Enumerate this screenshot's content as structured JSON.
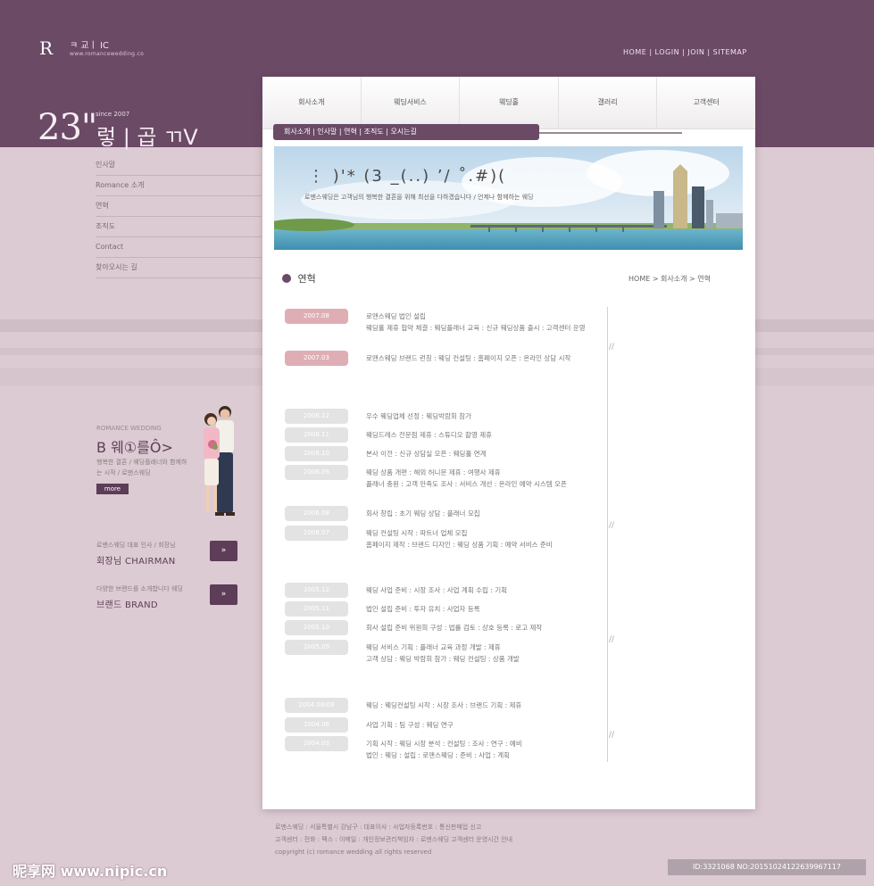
{
  "header": {
    "logo_letter": "R",
    "logo_name": "ㅋ 교ㅣ IC",
    "logo_sub": "www.romancewedding.co",
    "top_links": "HOME | LOGIN | JOIN | SITEMAP",
    "hero_number": "23\"",
    "hero_small": "since 2007",
    "hero_title": "렇 | 곱 ㄲV"
  },
  "left_nav": {
    "items": [
      "인사말",
      "Romance 소개",
      "연혁",
      "조직도",
      "Contact",
      "찾아오시는 길"
    ]
  },
  "promo": {
    "kicker": "ROMANCE WEDDING",
    "title": "B 웨①를Ô>",
    "desc": "행복한 결혼 / 웨딩플래너와 함께하는 시작 / 로맨스웨딩",
    "badge": "more"
  },
  "side_blocks": [
    {
      "desc": "로맨스웨딩 대표 인사 / 회장님",
      "name": "회장님 CHAIRMAN",
      "arrow": "»"
    },
    {
      "desc": "다양한 브랜드를 소개합니다 웨딩",
      "name": "브랜드 BRAND",
      "arrow": "»"
    }
  ],
  "tabs": [
    "회사소개",
    "웨딩서비스",
    "웨딩홀",
    "갤러리",
    "고객센터"
  ],
  "subnav": "회사소개 | 인사말 | 연혁 | 조직도 | 오시는길",
  "banner": {
    "title": "⋮ )'*   (3    _(..)   ’/   ˚.#)(",
    "sub": "로맨스웨딩은 고객님의 행복한 결혼을 위해 최선을 다하겠습니다 / 언제나 함께하는 웨딩"
  },
  "section": {
    "title": "연혁",
    "breadcrumb": "HOME > 회사소개 > 연혁"
  },
  "timeline_marks": [
    "//",
    "//",
    "//",
    "//"
  ],
  "timeline": [
    {
      "date": "2007.08",
      "accent": true,
      "lines": [
        "로맨스웨딩 법인 설립",
        "웨딩홀 제휴 협약 체결 : 웨딩플래너 교육 : 신규 웨딩상품 출시 : 고객센터 운영"
      ]
    },
    {
      "date": "2007.03",
      "accent": true,
      "lines": [
        "로맨스웨딩 브랜드 런칭 : 웨딩 컨설팅 : 홈페이지 오픈 : 온라인 상담 시작"
      ]
    },
    {
      "date": "2006.12",
      "accent": false,
      "lines": [
        "우수 웨딩업체 선정 : 웨딩박람회 참가"
      ]
    },
    {
      "date": "2006.11",
      "accent": false,
      "lines": [
        "웨딩드레스 전문점 제휴 : 스튜디오 촬영 제휴"
      ]
    },
    {
      "date": "2006.10",
      "accent": false,
      "lines": [
        "본사 이전 : 신규 상담실 오픈 : 웨딩홀 연계"
      ]
    },
    {
      "date": "2006.09",
      "accent": false,
      "lines": [
        "웨딩 상품 개편 : 해외 허니문 제휴 : 여행사 제휴",
        "플래너 충원 : 고객 만족도 조사 : 서비스 개선 : 온라인 예약 시스템 오픈"
      ]
    },
    {
      "date": "2006.08",
      "accent": false,
      "lines": [
        "회사 창립 : 초기 웨딩 상담 : 플래너 모집"
      ]
    },
    {
      "date": "2006.07",
      "accent": false,
      "lines": [
        "웨딩 컨설팅 시작 : 파트너 업체 모집",
        "홈페이지 제작 : 브랜드 디자인 : 웨딩 상품 기획 : 예약 서비스 준비"
      ]
    },
    {
      "date": "2005.12",
      "accent": false,
      "lines": [
        "웨딩 사업 준비 : 시장 조사 : 사업 계획 수립 : 기획"
      ]
    },
    {
      "date": "2005.11",
      "accent": false,
      "lines": [
        "법인 설립 준비 : 투자 유치 : 사업자 등록"
      ]
    },
    {
      "date": "2005.10",
      "accent": false,
      "lines": [
        "회사 설립 준비 위원회 구성 : 법률 검토 : 상호 등록 : 로고 제작"
      ]
    },
    {
      "date": "2005.09",
      "accent": false,
      "lines": [
        "웨딩 서비스 기획 : 플래너 교육 과정 개발 : 제휴",
        "고객 상담 : 웨딩 박람회 참가 : 웨딩 컨설팅 : 상품 개발"
      ]
    },
    {
      "date": "2004.08/09",
      "accent": false,
      "lines": [
        "웨딩 : 웨딩컨설팅 시작 : 시장 조사 : 브랜드 기획 : 제휴"
      ]
    },
    {
      "date": "2004.06",
      "accent": false,
      "lines": [
        "사업 기획 : 팀 구성 : 웨딩 연구"
      ]
    },
    {
      "date": "2004.03",
      "accent": false,
      "lines": [
        "기획 시작 : 웨딩 시장 분석 : 컨설팅 : 조사 : 연구 : 예비",
        "법인 : 웨딩 : 설립 : 로맨스웨딩 : 준비 : 사업 : 계획"
      ]
    }
  ],
  "footer": {
    "line1": "로맨스웨딩 : 서울특별시 강남구 : 대표이사 : 사업자등록번호 : 통신판매업 신고",
    "line2": "고객센터 : 전화 : 팩스 : 이메일 : 개인정보관리책임자 : 로맨스웨딩 고객센터 운영시간 안내",
    "line3": "copyright (c) romance wedding all rights reserved"
  },
  "watermarks": {
    "left": "昵享网 www.nipic.cn",
    "right": "ID:3321068 NO:20151024122639967117"
  },
  "colors": {
    "header_bg": "#6b4a66",
    "page_bg": "#dccbd2",
    "accent_pill": "#dfaeb5",
    "neutral_pill": "#e3e3e3"
  }
}
